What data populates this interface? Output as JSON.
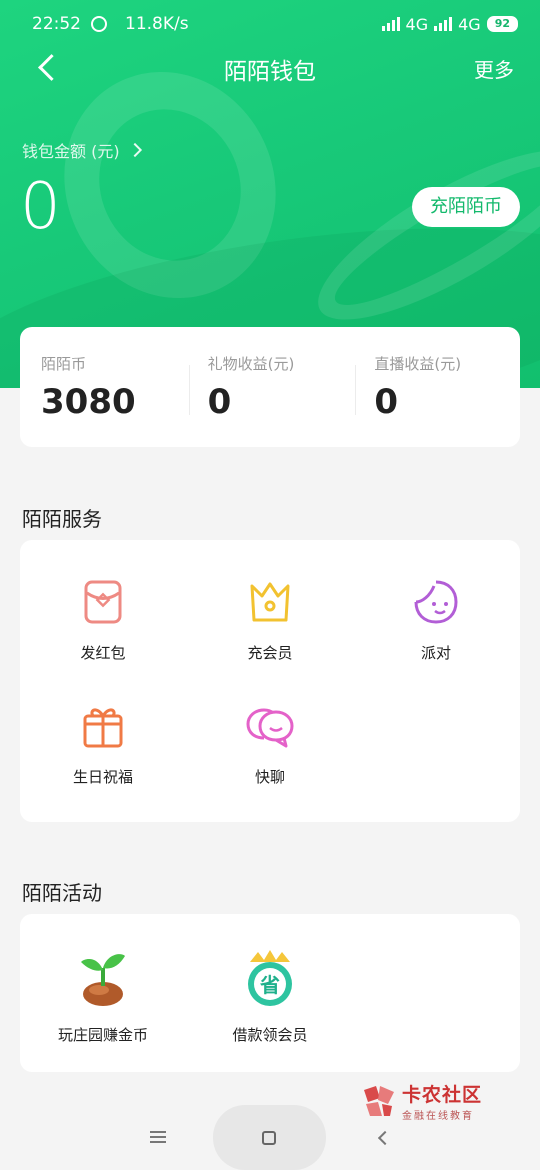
{
  "status_bar": {
    "time": "22:52",
    "speed": "11.8K/s",
    "network_1": "4G",
    "network_2": "4G",
    "battery": "92"
  },
  "header": {
    "title": "陌陌钱包",
    "more_label": "更多"
  },
  "wallet": {
    "balance_label": "钱包金额 (元)",
    "balance_value": "0",
    "recharge_label": "充陌陌币"
  },
  "stats": [
    {
      "label": "陌陌币",
      "value": "3080"
    },
    {
      "label": "礼物收益(元)",
      "value": "0"
    },
    {
      "label": "直播收益(元)",
      "value": "0"
    }
  ],
  "services": {
    "title": "陌陌服务",
    "items": [
      {
        "label": "发红包",
        "icon": "red-packet-icon"
      },
      {
        "label": "充会员",
        "icon": "crown-icon"
      },
      {
        "label": "派对",
        "icon": "party-face-icon"
      },
      {
        "label": "生日祝福",
        "icon": "gift-box-icon"
      },
      {
        "label": "快聊",
        "icon": "chat-bubbles-icon"
      }
    ]
  },
  "activities": {
    "title": "陌陌活动",
    "items": [
      {
        "label": "玩庄园赚金币",
        "icon": "sprout-icon"
      },
      {
        "label": "借款领会员",
        "icon": "save-badge-icon",
        "badge_text": "省"
      }
    ]
  },
  "watermark": {
    "name": "卡农社区",
    "tagline": "金融在线教育"
  },
  "colors": {
    "brand_green": "#18c979",
    "accent_text": "#13b96c",
    "card_bg": "#ffffff",
    "page_bg": "#f4f4f4"
  }
}
